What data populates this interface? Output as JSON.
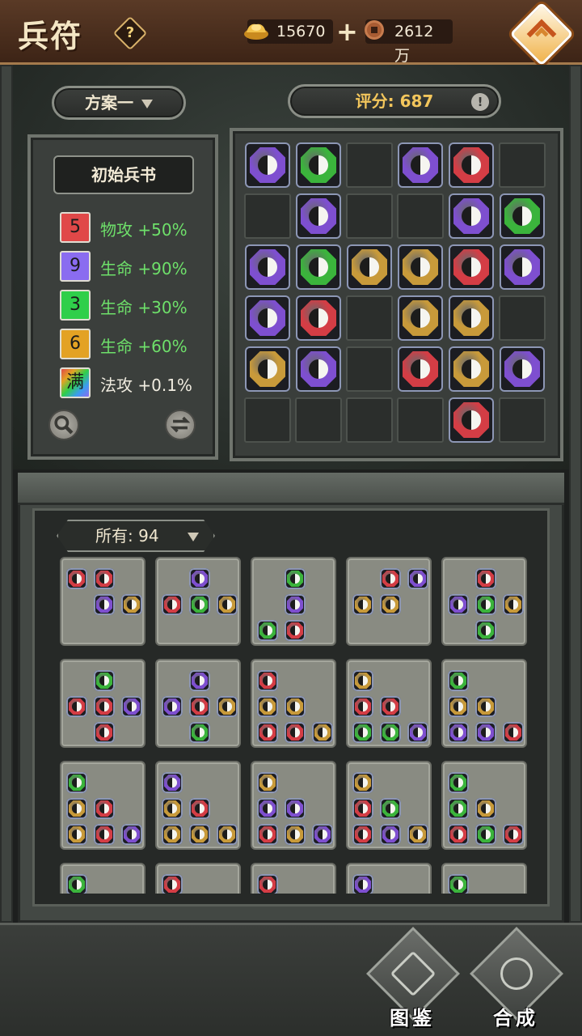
{
  "header": {
    "title": "兵符",
    "help_label": "?",
    "gold": "15670",
    "copper": "2612万",
    "plus_label": "+"
  },
  "plan": {
    "label": "方案一"
  },
  "score": {
    "text": "评分: 687",
    "info_label": "!"
  },
  "book": {
    "title": "初始兵书",
    "bonuses": [
      {
        "count": "5",
        "label": "物攻 +50%",
        "color": "#e04848",
        "text_color": "#6ee06a"
      },
      {
        "count": "9",
        "label": "生命 +90%",
        "color": "#8a6cf0",
        "text_color": "#6ee06a"
      },
      {
        "count": "3",
        "label": "生命 +30%",
        "color": "#2fcf4a",
        "text_color": "#6ee06a"
      },
      {
        "count": "6",
        "label": "生命 +60%",
        "color": "#e3a224",
        "text_color": "#6ee06a"
      },
      {
        "count": "满",
        "label": "法攻 +0.1%",
        "color": "rainbow",
        "text_color": "#f0ece0"
      }
    ]
  },
  "gem_colors": {
    "P": "#7e4fd0",
    "G": "#3bb43c",
    "R": "#d43d45",
    "Y": "#c89a3a"
  },
  "board": [
    [
      "P",
      "G",
      "",
      "P",
      "R",
      ""
    ],
    [
      "",
      "P",
      "",
      "",
      "P",
      "G"
    ],
    [
      "P",
      "G",
      "Y",
      "Y",
      "R",
      "P"
    ],
    [
      "P",
      "R",
      "",
      "Y",
      "Y",
      ""
    ],
    [
      "Y",
      "P",
      "",
      "R",
      "Y",
      "P"
    ],
    [
      "",
      "",
      "",
      "",
      "R",
      ""
    ]
  ],
  "filter": {
    "label": "所有: 94"
  },
  "cards": [
    [
      [
        0,
        0,
        "R"
      ],
      [
        0,
        1,
        "R"
      ],
      [
        1,
        1,
        "P"
      ],
      [
        1,
        2,
        "Y"
      ]
    ],
    [
      [
        0,
        1,
        "P"
      ],
      [
        1,
        0,
        "R"
      ],
      [
        1,
        1,
        "G"
      ],
      [
        1,
        2,
        "Y"
      ]
    ],
    [
      [
        0,
        1,
        "G"
      ],
      [
        1,
        1,
        "P"
      ],
      [
        2,
        0,
        "G"
      ],
      [
        2,
        1,
        "R"
      ]
    ],
    [
      [
        0,
        1,
        "R"
      ],
      [
        0,
        2,
        "P"
      ],
      [
        1,
        0,
        "Y"
      ],
      [
        1,
        1,
        "Y"
      ]
    ],
    [
      [
        0,
        1,
        "R"
      ],
      [
        1,
        0,
        "P"
      ],
      [
        1,
        1,
        "G"
      ],
      [
        1,
        2,
        "Y"
      ],
      [
        2,
        1,
        "G"
      ]
    ],
    [
      [
        0,
        1,
        "G"
      ],
      [
        1,
        0,
        "R"
      ],
      [
        1,
        1,
        "R"
      ],
      [
        1,
        2,
        "P"
      ],
      [
        2,
        1,
        "R"
      ]
    ],
    [
      [
        0,
        1,
        "P"
      ],
      [
        1,
        0,
        "P"
      ],
      [
        1,
        1,
        "R"
      ],
      [
        1,
        2,
        "Y"
      ],
      [
        2,
        1,
        "G"
      ]
    ],
    [
      [
        0,
        0,
        "R"
      ],
      [
        1,
        0,
        "Y"
      ],
      [
        1,
        1,
        "Y"
      ],
      [
        2,
        0,
        "R"
      ],
      [
        2,
        1,
        "R"
      ],
      [
        2,
        2,
        "Y"
      ]
    ],
    [
      [
        0,
        0,
        "Y"
      ],
      [
        1,
        0,
        "R"
      ],
      [
        1,
        1,
        "R"
      ],
      [
        2,
        0,
        "G"
      ],
      [
        2,
        1,
        "G"
      ],
      [
        2,
        2,
        "P"
      ]
    ],
    [
      [
        0,
        0,
        "G"
      ],
      [
        1,
        0,
        "Y"
      ],
      [
        1,
        1,
        "Y"
      ],
      [
        2,
        0,
        "P"
      ],
      [
        2,
        1,
        "P"
      ],
      [
        2,
        2,
        "R"
      ]
    ],
    [
      [
        0,
        0,
        "G"
      ],
      [
        1,
        0,
        "Y"
      ],
      [
        1,
        1,
        "R"
      ],
      [
        2,
        0,
        "Y"
      ],
      [
        2,
        1,
        "R"
      ],
      [
        2,
        2,
        "P"
      ]
    ],
    [
      [
        0,
        0,
        "P"
      ],
      [
        1,
        0,
        "Y"
      ],
      [
        1,
        1,
        "R"
      ],
      [
        2,
        0,
        "Y"
      ],
      [
        2,
        1,
        "Y"
      ],
      [
        2,
        2,
        "Y"
      ]
    ],
    [
      [
        0,
        0,
        "Y"
      ],
      [
        1,
        0,
        "P"
      ],
      [
        1,
        1,
        "P"
      ],
      [
        2,
        0,
        "R"
      ],
      [
        2,
        1,
        "Y"
      ],
      [
        2,
        2,
        "P"
      ]
    ],
    [
      [
        0,
        0,
        "Y"
      ],
      [
        1,
        0,
        "R"
      ],
      [
        1,
        1,
        "G"
      ],
      [
        2,
        0,
        "R"
      ],
      [
        2,
        1,
        "P"
      ],
      [
        2,
        2,
        "Y"
      ]
    ],
    [
      [
        0,
        0,
        "G"
      ],
      [
        1,
        0,
        "G"
      ],
      [
        1,
        1,
        "Y"
      ],
      [
        2,
        0,
        "R"
      ],
      [
        2,
        1,
        "G"
      ],
      [
        2,
        2,
        "R"
      ]
    ],
    [
      [
        0,
        0,
        "G"
      ]
    ],
    [
      [
        0,
        0,
        "R"
      ]
    ],
    [
      [
        0,
        0,
        "R"
      ]
    ],
    [
      [
        0,
        0,
        "P"
      ]
    ],
    [
      [
        0,
        0,
        "G"
      ]
    ]
  ],
  "buttons": {
    "atlas": "图鉴",
    "synthesize": "合成"
  }
}
